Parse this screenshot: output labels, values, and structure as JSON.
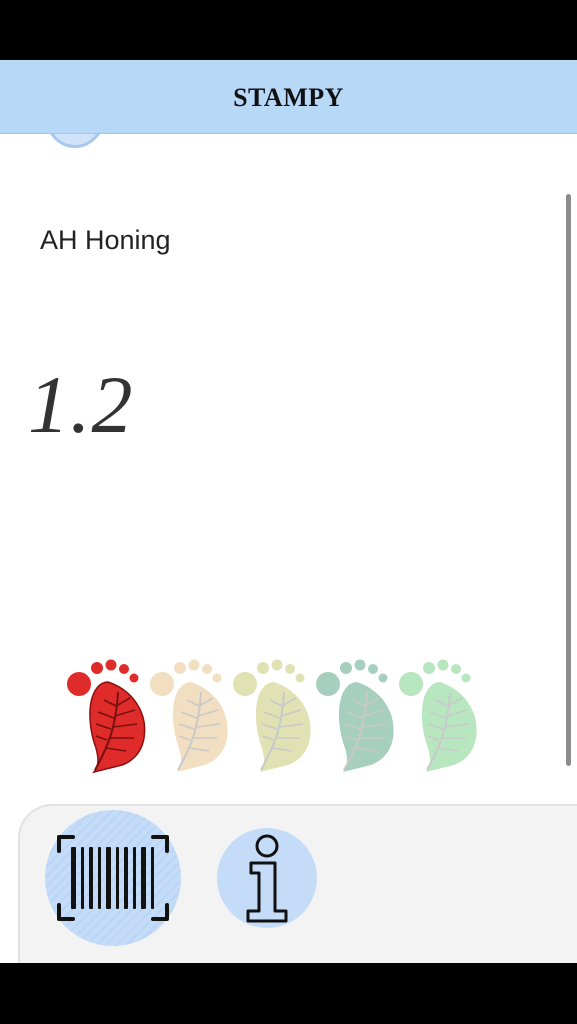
{
  "app": {
    "title": "STAMPY"
  },
  "product": {
    "name": "AH Honing",
    "score": "1.2"
  },
  "rating": {
    "levels": 5,
    "active_level": 1,
    "colors": [
      "#e02b2b",
      "#f2dfc2",
      "#e0e2b4",
      "#a6cfbd",
      "#b7e6bf"
    ]
  },
  "actions": {
    "scan_icon": "barcode-scan-icon",
    "info_icon": "info-icon"
  }
}
